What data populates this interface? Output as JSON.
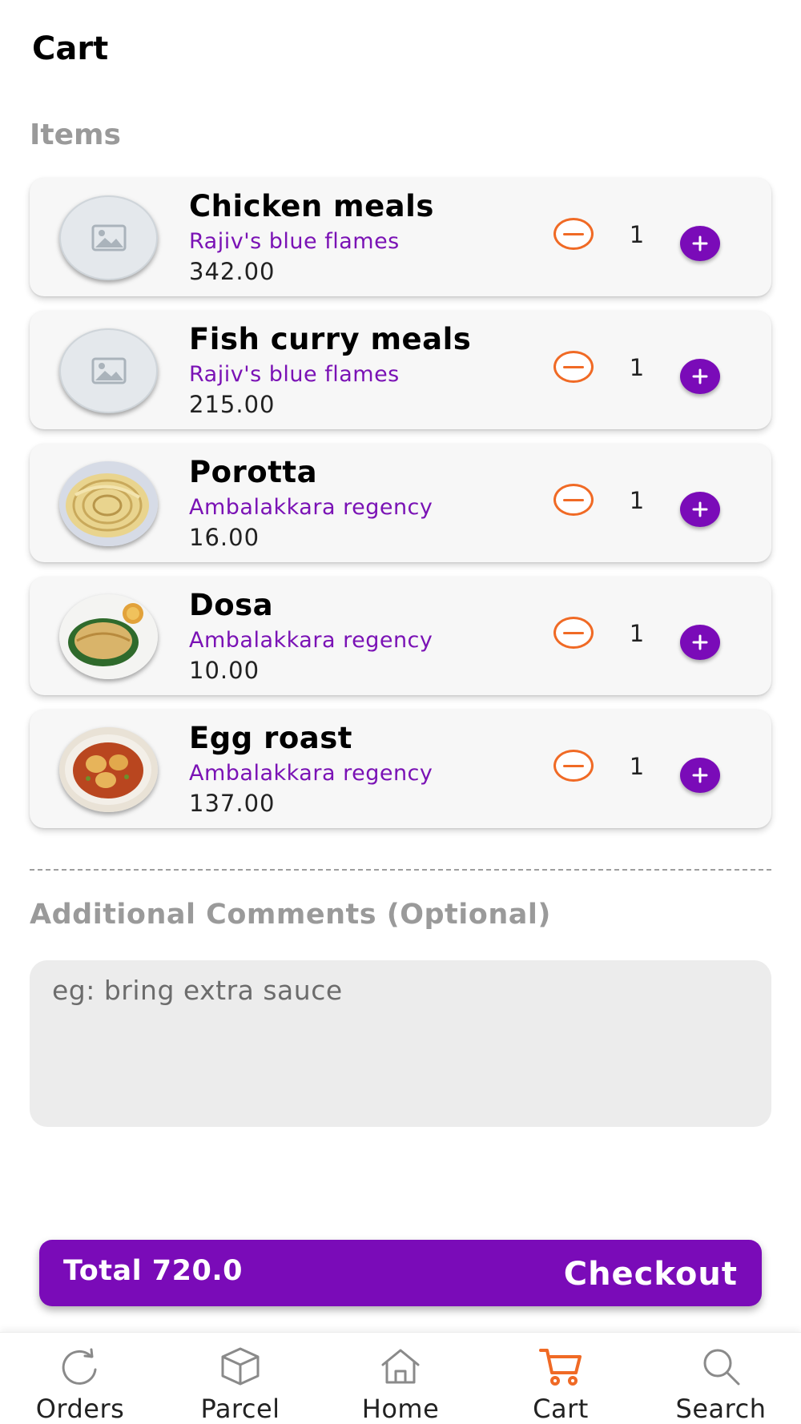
{
  "header": {
    "title": "Cart"
  },
  "items_section": {
    "title": "Items"
  },
  "items": [
    {
      "name": "Chicken meals",
      "vendor": "Rajiv's blue flames",
      "price": "342.00",
      "quantity": "1",
      "image": "image-placeholder-icon"
    },
    {
      "name": "Fish curry meals",
      "vendor": "Rajiv's blue flames",
      "price": "215.00",
      "quantity": "1",
      "image": "image-placeholder-icon"
    },
    {
      "name": "Porotta",
      "vendor": "Ambalakkara regency",
      "price": "16.00",
      "quantity": "1",
      "image": "porotta-photo"
    },
    {
      "name": "Dosa",
      "vendor": "Ambalakkara regency",
      "price": "10.00",
      "quantity": "1",
      "image": "dosa-photo"
    },
    {
      "name": "Egg roast",
      "vendor": "Ambalakkara regency",
      "price": "137.00",
      "quantity": "1",
      "image": "egg-roast-photo"
    }
  ],
  "comments": {
    "label": "Additional Comments (Optional)",
    "placeholder": "eg: bring extra sauce",
    "value": ""
  },
  "checkout": {
    "total_label": "Total 720.0",
    "button_label": "Checkout"
  },
  "bottom_nav": {
    "items": [
      {
        "label": "Orders",
        "icon": "refresh-icon"
      },
      {
        "label": "Parcel",
        "icon": "box-icon"
      },
      {
        "label": "Home",
        "icon": "home-icon"
      },
      {
        "label": "Cart",
        "icon": "cart-icon",
        "active": true
      },
      {
        "label": "Search",
        "icon": "search-icon"
      }
    ]
  },
  "colors": {
    "accent_purple": "#7a0bb8",
    "vendor_purple": "#7a12b5",
    "accent_orange": "#f06a25",
    "card_bg": "#f7f7f7",
    "input_bg": "#ececec",
    "muted_text": "#9a9a9a"
  }
}
